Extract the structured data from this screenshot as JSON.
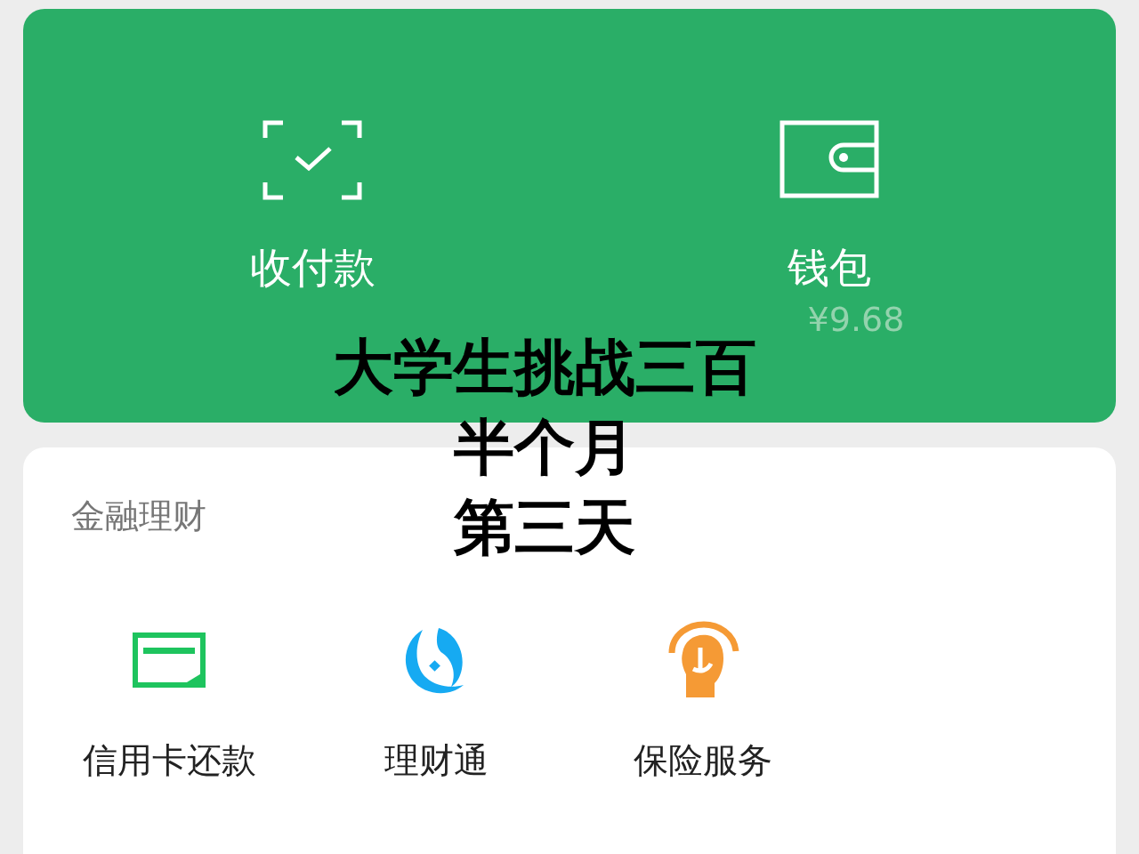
{
  "top_actions": [
    {
      "kind": "scan",
      "label": "收付款"
    },
    {
      "kind": "wallet",
      "label": "钱包",
      "balance": "¥9.68"
    }
  ],
  "finance": {
    "title": "金融理财",
    "items": [
      {
        "kind": "card",
        "label": "信用卡还款"
      },
      {
        "kind": "fund",
        "label": "理财通"
      },
      {
        "kind": "insurance",
        "label": "保险服务"
      }
    ]
  },
  "caption": {
    "lines": [
      "大学生挑战三百",
      "半个月",
      "第三天"
    ]
  }
}
